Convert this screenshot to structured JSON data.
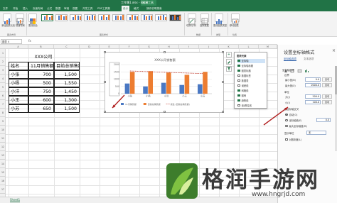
{
  "app": {
    "title": "工作簿1.xlsx - Excel",
    "context_tab": "图表工具"
  },
  "tabs": [
    "文件",
    "开始",
    "插入",
    "页面布局",
    "公式",
    "数据",
    "审阅",
    "视图",
    "开发工具",
    "PDF工具集",
    "设计",
    "格式",
    "操作说明搜索"
  ],
  "ribbon": {
    "groups": [
      "图表布局",
      "图表样式",
      "数据",
      "类型",
      "位置"
    ],
    "buttons": [
      "添加图表元素",
      "快速布局",
      "更改颜色",
      "切换行/列",
      "选择数据",
      "更改图表类型",
      "移动图表"
    ]
  },
  "formula_bar": {
    "name_box": "图表 4",
    "fx": "fx"
  },
  "columns": [
    "A",
    "B",
    "C",
    "D",
    "E",
    "F",
    "G",
    "H",
    "I",
    "J",
    "K",
    "L",
    "M"
  ],
  "rows": [
    "1",
    "2",
    "3",
    "4",
    "5",
    "6",
    "7",
    "8",
    "9",
    "10",
    "11",
    "12",
    "13",
    "14",
    "15",
    "16",
    "17",
    "18"
  ],
  "table": {
    "title": "XXX公司",
    "headers": [
      "姓名",
      "11月销售额",
      "目前总销售额"
    ],
    "rows": [
      [
        "小张",
        "700",
        "1,500"
      ],
      [
        "小杨",
        "500",
        "1,550"
      ],
      [
        "小洋",
        "750",
        "1,450"
      ],
      [
        "小王",
        "600",
        "1,300"
      ],
      [
        "小苏",
        "650",
        "1,500"
      ]
    ]
  },
  "chart_data": {
    "type": "bar",
    "title": "XXX公司销售额",
    "categories": [
      "小张",
      "小杨",
      "小洋",
      "小王",
      "小苏"
    ],
    "series": [
      {
        "name": "11月销售额",
        "type": "bar",
        "color": "#4a78c3",
        "values": [
          700,
          500,
          750,
          600,
          650
        ]
      },
      {
        "name": "目前总销售额",
        "type": "bar",
        "color": "#ed7d31",
        "values": [
          1500,
          1550,
          1450,
          1300,
          1500
        ]
      },
      {
        "name": "线性 (目前总销售额)",
        "type": "trendline",
        "color": "#c0392b",
        "values": [
          1560,
          1515,
          1470,
          1425,
          1380
        ]
      }
    ],
    "ylim": [
      0,
      2000
    ],
    "yticks": [
      0,
      500,
      1000,
      1500,
      2000
    ],
    "gridlines": true,
    "legend": "bottom",
    "xlabel": "",
    "ylabel": ""
  },
  "chart_elements": {
    "header": "图表元素",
    "items": [
      {
        "label": "坐标轴",
        "checked": true
      },
      {
        "label": "坐标轴标题",
        "checked": true
      },
      {
        "label": "图表标题",
        "checked": true
      },
      {
        "label": "数据标签",
        "checked": false
      },
      {
        "label": "数据表",
        "checked": false
      },
      {
        "label": "误差线",
        "checked": false
      },
      {
        "label": "网格线",
        "checked": true
      },
      {
        "label": "图例",
        "checked": true
      },
      {
        "label": "趋势线",
        "checked": true
      },
      {
        "label": "涨/跌柱线",
        "checked": false
      }
    ]
  },
  "format_pane": {
    "title": "设置坐标轴格式",
    "tabs": [
      "坐标轴选项",
      "文本选项"
    ],
    "sections": {
      "axis_options": "坐标轴选项",
      "bounds": "边界",
      "units": "单位",
      "cross": "横坐标轴交叉",
      "display_units": "显示单位"
    },
    "fields": [
      {
        "label": "最小值(N)",
        "value": "0.0",
        "btn": "自动"
      },
      {
        "label": "最大值(X)",
        "value": "2000.0",
        "btn": "自动"
      },
      {
        "label": "大(J)",
        "value": "500.0",
        "btn": "自动"
      },
      {
        "label": "小(I)",
        "value": "100.0",
        "btn": "自动"
      }
    ],
    "radios": [
      {
        "label": "自动(O)",
        "on": true
      },
      {
        "label": "坐标轴值(E)",
        "on": false
      },
      {
        "label": "最大坐标轴值(M)",
        "on": false
      }
    ],
    "axis_value": "0.0",
    "display_unit_value": "无",
    "log_scale": "对数刻度(L)"
  },
  "sheet": {
    "name": "Sheet1"
  },
  "watermark": {
    "text": "格润手游网",
    "url": "www.hngrjd.com"
  }
}
